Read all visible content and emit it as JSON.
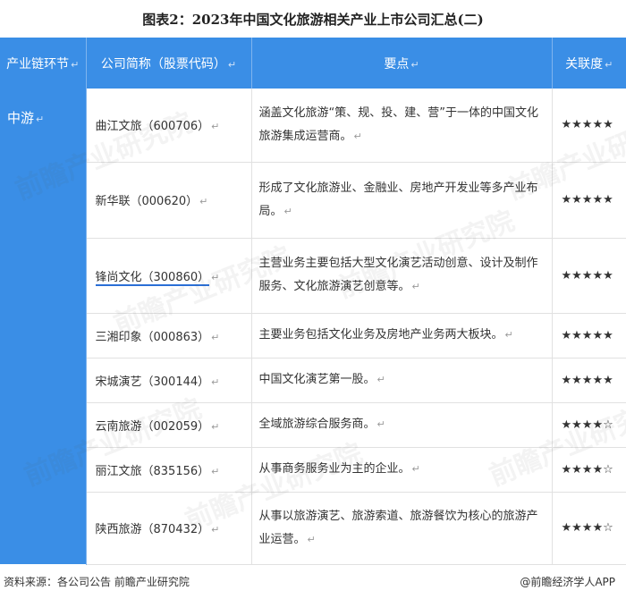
{
  "title": "图表2：2023年中国文化旅游相关产业上市公司汇总(二)",
  "return_mark": "↵",
  "headers": {
    "stage": "产业链环节",
    "company": "公司简称（股票代码）",
    "key_points": "要点",
    "relevance": "关联度"
  },
  "stage": "中游",
  "rows": [
    {
      "company": "曲江文旅（600706）",
      "key_points": "涵盖文化旅游“策、规、投、建、营”于一体的中国文化旅游集成运营商。",
      "relevance": "★★★★★"
    },
    {
      "company": "新华联（000620）",
      "key_points": "形成了文化旅游业、金融业、房地产开发业等多产业布局。",
      "relevance": "★★★★★"
    },
    {
      "company": "锋尚文化（300860）",
      "key_points": "主营业务主要包括大型文化演艺活动创意、设计及制作服务、文化旅游演艺创意等。",
      "relevance": "★★★★★"
    },
    {
      "company": "三湘印象（000863）",
      "key_points": "主要业务包括文化业务及房地产业务两大板块。",
      "relevance": "★★★★★"
    },
    {
      "company": "宋城演艺（300144）",
      "key_points": "中国文化演艺第一股。",
      "relevance": "★★★★★"
    },
    {
      "company": "云南旅游（002059）",
      "key_points": "全域旅游综合服务商。",
      "relevance": "★★★★☆"
    },
    {
      "company": "丽江文旅（835156）",
      "key_points": "从事商务服务业为主的企业。",
      "relevance": "★★★★☆"
    },
    {
      "company": "陕西旅游（870432）",
      "key_points": "从事以旅游演艺、旅游索道、旅游餐饮为核心的旅游产业运营。",
      "relevance": "★★★★☆"
    }
  ],
  "footer": {
    "source": "资料来源：各公司公告 前瞻产业研究院",
    "brand": "@前瞻经济学人APP"
  },
  "watermark": "前瞻产业研究院"
}
